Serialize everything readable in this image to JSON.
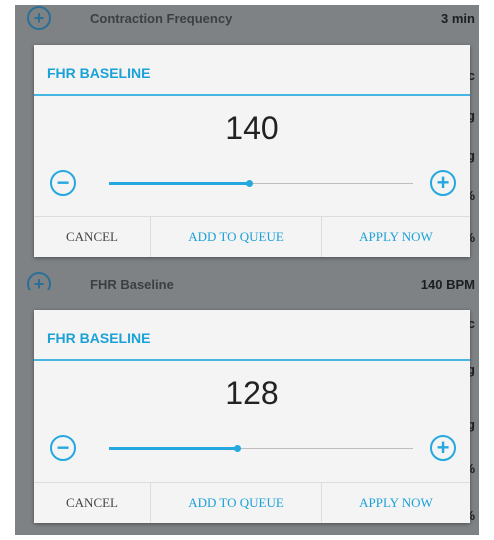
{
  "colors": {
    "accent": "#24a8df",
    "title": "#1aa1d8",
    "backdrop": "#7e8285"
  },
  "background": {
    "top_row": {
      "label": "Contraction Frequency",
      "value": "3 min"
    },
    "mid_row": {
      "label": "FHR Baseline",
      "value": "140 BPM"
    },
    "side_chars_top": [
      "c",
      "g",
      "g",
      "%",
      "%"
    ],
    "side_chars_bottom": [
      "c",
      "g",
      "g",
      "%",
      "%"
    ]
  },
  "dialogs": [
    {
      "title": "FHR BASELINE",
      "value": "140",
      "slider_fraction": 0.46,
      "actions": {
        "cancel": "CANCEL",
        "add_to_queue": "ADD TO QUEUE",
        "apply_now": "APPLY NOW"
      }
    },
    {
      "title": "FHR BASELINE",
      "value": "128",
      "slider_fraction": 0.42,
      "actions": {
        "cancel": "CANCEL",
        "add_to_queue": "ADD TO QUEUE",
        "apply_now": "APPLY NOW"
      }
    }
  ]
}
